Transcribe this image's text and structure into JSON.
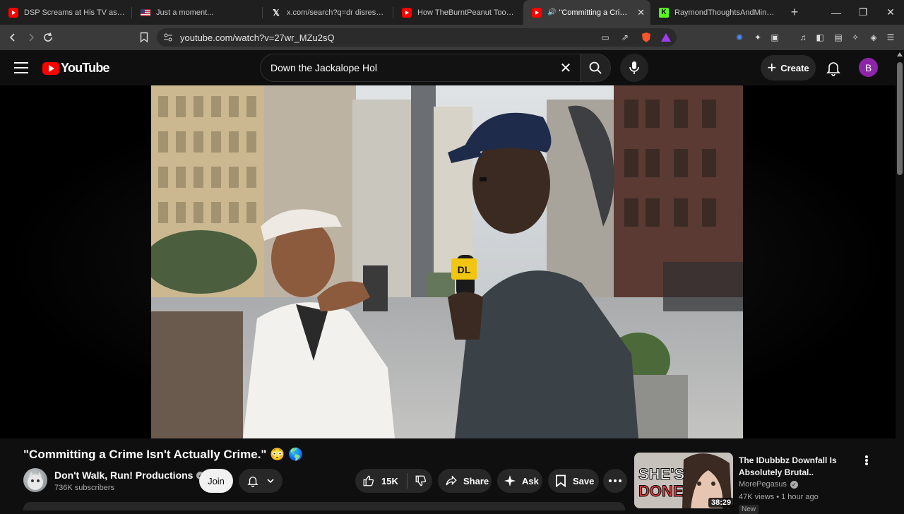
{
  "browser": {
    "tabs": [
      {
        "title": "DSP Screams at His TV as Call of",
        "favicon": "youtube-icon",
        "active": false
      },
      {
        "title": "Just a moment...",
        "favicon": "flag-icon",
        "active": false
      },
      {
        "title": "x.com/search?q=dr disrespect m",
        "favicon": "x-icon",
        "active": false
      },
      {
        "title": "How TheBurntPeanut Took Over",
        "favicon": "youtube-icon",
        "active": false
      },
      {
        "title": "\"Committing a Crime Isn",
        "favicon": "youtube-icon",
        "active": true
      },
      {
        "title": "RaymondThoughtsAndMind Str",
        "favicon": "kick-icon",
        "active": false
      }
    ],
    "url": "youtube.com/watch?v=27wr_MZu2sQ",
    "brave_badge": "9+"
  },
  "youtube": {
    "logo_text": "YouTube",
    "search_value": "Down the Jackalope Hol",
    "create_label": "Create",
    "avatar_initial": "B",
    "accent": "#ff0000"
  },
  "video": {
    "overlay_logo": "DL",
    "title": "\"Committing a Crime Isn't Actually Crime.\" 😳 🌎",
    "channel_name": "Don't Walk, Run! Productions",
    "subscribers": "736K subscribers",
    "join_label": "Join",
    "likes": "15K",
    "share_label": "Share",
    "ask_label": "Ask",
    "save_label": "Save"
  },
  "recommendation": {
    "title": "The IDubbbz Downfall Is Absolutely Brutal..",
    "channel": "MorePegasus",
    "meta": "47K views • 1 hour ago",
    "duration": "38:29",
    "thumb_text": "SHE'S DONE",
    "badge": "New"
  }
}
